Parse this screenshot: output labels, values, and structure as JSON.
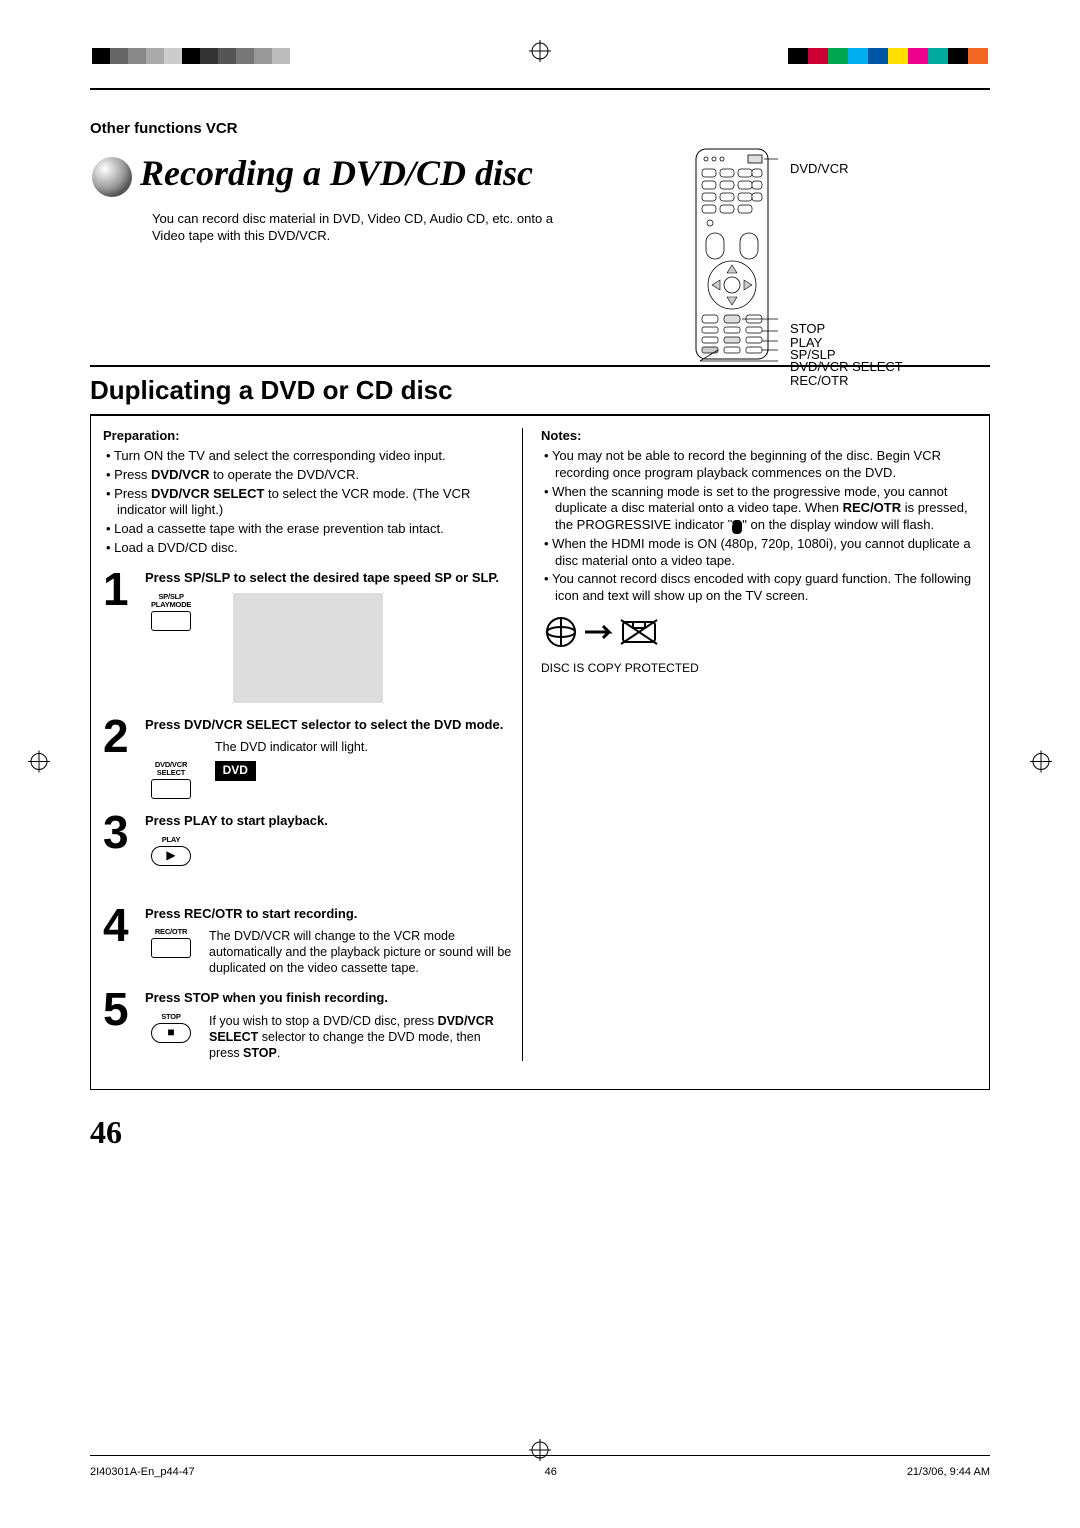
{
  "header": {
    "section": "Other functions VCR"
  },
  "title": "Recording a DVD/CD disc",
  "intro": "You can record disc material in DVD, Video CD, Audio CD, etc. onto a Video tape with this DVD/VCR.",
  "remote_labels": {
    "l1": "DVD/VCR",
    "l2": "STOP",
    "l3": "PLAY",
    "l4": "SP/SLP",
    "l5": "DVD/VCR SELECT",
    "l6": "REC/OTR"
  },
  "subheading": "Duplicating a DVD or CD disc",
  "prep": {
    "title": "Preparation:",
    "items": [
      "Turn ON the TV and select the corresponding video input.",
      "Press DVD/VCR to operate the DVD/VCR.",
      "Press DVD/VCR SELECT to select the VCR mode. (The VCR indicator will light.)",
      "Load a cassette tape with the erase prevention tab intact.",
      "Load a DVD/CD disc."
    ]
  },
  "steps": [
    {
      "n": "1",
      "title": "Press SP/SLP to select the desired tape speed SP or SLP.",
      "caption": "SP/SLP\nPLAYMODE"
    },
    {
      "n": "2",
      "title": "Press DVD/VCR SELECT selector to select the DVD mode.",
      "note": "The DVD indicator will light.",
      "caption": "DVD/VCR\nSELECT",
      "badge": "DVD"
    },
    {
      "n": "3",
      "title": "Press PLAY to start playback.",
      "caption": "PLAY"
    },
    {
      "n": "4",
      "title": "Press REC/OTR to start recording.",
      "note": "The DVD/VCR will change to the VCR mode automatically and the playback picture or sound will be duplicated on the video cassette tape.",
      "caption": "REC/OTR"
    },
    {
      "n": "5",
      "title": "Press STOP when you finish recording.",
      "note_html": "If you wish to stop a DVD/CD disc, press DVD/VCR SELECT selector to change the DVD mode, then press STOP.",
      "caption": "STOP"
    }
  ],
  "notes": {
    "title": "Notes:",
    "items": [
      "You may not be able to record the beginning of the disc. Begin VCR recording once program playback commences on the DVD.",
      "When the scanning mode is set to the progressive mode, you cannot duplicate a disc material onto a video tape. When REC/OTR is pressed, the PROGRESSIVE indicator “ P ” on the display window will flash.",
      "When the HDMI mode is ON (480p, 720p, 1080i), you cannot duplicate a disc material onto a video tape.",
      "You cannot record discs encoded with copy guard function. The following icon and text will show up on the TV screen."
    ],
    "disc_protected": "DISC IS COPY PROTECTED"
  },
  "page_number": "46",
  "footer": {
    "file": "2I40301A-En_p44-47",
    "page": "46",
    "timestamp": "21/3/06, 9:44 AM"
  },
  "swatches": {
    "left": [
      "#000",
      "#666",
      "#888",
      "#aaa",
      "#ccc",
      "#000",
      "#333",
      "#555",
      "#777",
      "#999",
      "#bbb"
    ],
    "right": [
      "#000",
      "#cc0033",
      "#00a650",
      "#00aeef",
      "#0055a5",
      "#ffde00",
      "#ec008c",
      "#00a99d",
      "#000",
      "#f26522"
    ]
  }
}
